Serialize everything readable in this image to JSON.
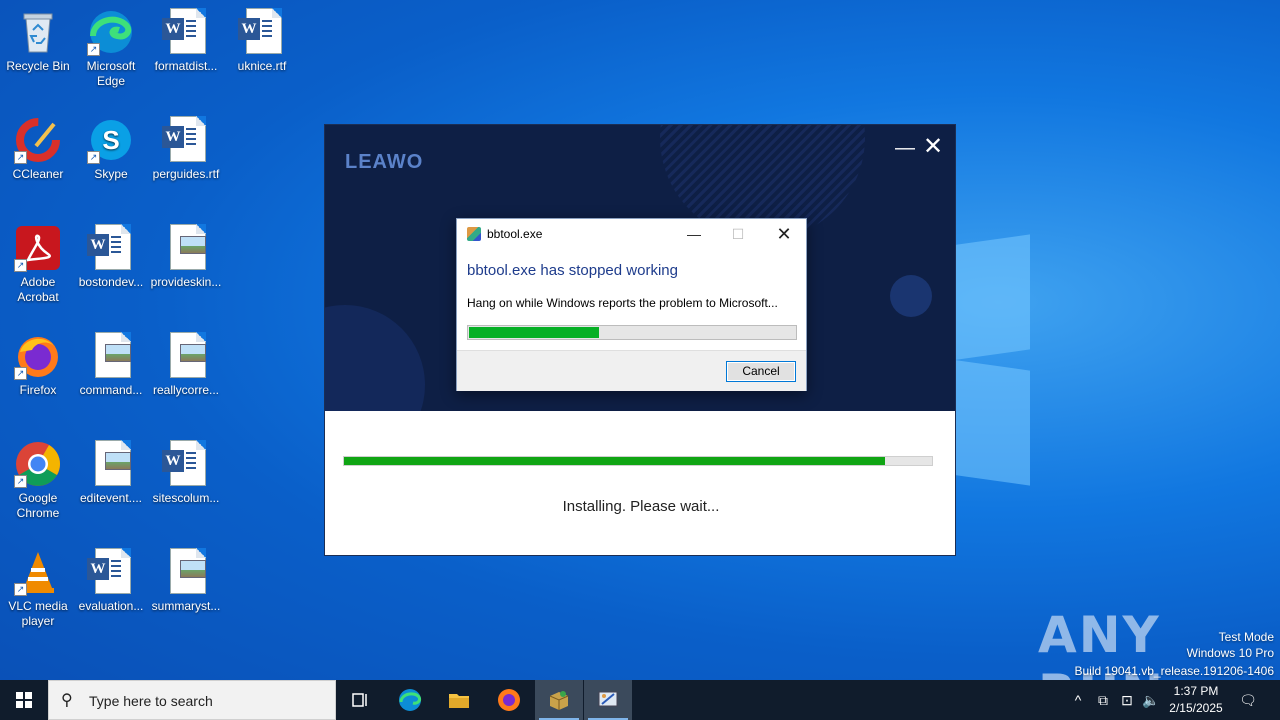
{
  "desktop": {
    "icons": [
      {
        "label": "Recycle Bin",
        "icon": "recycle-bin-icon"
      },
      {
        "label": "Microsoft Edge",
        "icon": "edge-icon"
      },
      {
        "label": "formatdist...",
        "icon": "word-doc-icon"
      },
      {
        "label": "uknice.rtf",
        "icon": "word-doc-icon"
      },
      {
        "label": "CCleaner",
        "icon": "ccleaner-icon"
      },
      {
        "label": "Skype",
        "icon": "skype-icon"
      },
      {
        "label": "perguides.rtf",
        "icon": "word-doc-icon"
      },
      {
        "label": "Adobe Acrobat",
        "icon": "acrobat-icon"
      },
      {
        "label": "bostondev...",
        "icon": "word-doc-icon"
      },
      {
        "label": "provideskin...",
        "icon": "image-file-icon"
      },
      {
        "label": "Firefox",
        "icon": "firefox-icon"
      },
      {
        "label": "command...",
        "icon": "image-file-icon"
      },
      {
        "label": "reallycorre...",
        "icon": "image-file-icon"
      },
      {
        "label": "Google Chrome",
        "icon": "chrome-icon"
      },
      {
        "label": "editevent....",
        "icon": "image-file-icon"
      },
      {
        "label": "sitescolum...",
        "icon": "word-doc-icon"
      },
      {
        "label": "VLC media player",
        "icon": "vlc-icon"
      },
      {
        "label": "evaluation...",
        "icon": "word-doc-icon"
      },
      {
        "label": "summaryst...",
        "icon": "image-file-icon"
      }
    ]
  },
  "installer": {
    "brand": "LEAWO",
    "minimize": "—",
    "close": "✕",
    "progress_percent": 92,
    "status": "Installing. Please wait..."
  },
  "dialog": {
    "title": "bbtool.exe",
    "heading": "bbtool.exe has stopped working",
    "message": "Hang on while Windows reports the problem to Microsoft...",
    "progress_percent": 40,
    "cancel_label": "Cancel",
    "min_glyph": "—",
    "max_glyph": "☐",
    "close_glyph": "✕"
  },
  "watermark": {
    "brand": "ANY RUN",
    "line1": "Test Mode",
    "line2": "Windows 10 Pro",
    "line3": "Build 19041.vb_release.191206-1406"
  },
  "taskbar": {
    "search_placeholder": "Type here to search",
    "time": "1:37 PM",
    "date": "2/15/2025"
  },
  "colors": {
    "installer_bg": "#0e1f45",
    "progress_green": "#10a514",
    "dialog_heading": "#1e3c8c",
    "taskbar": "#101c2c"
  }
}
